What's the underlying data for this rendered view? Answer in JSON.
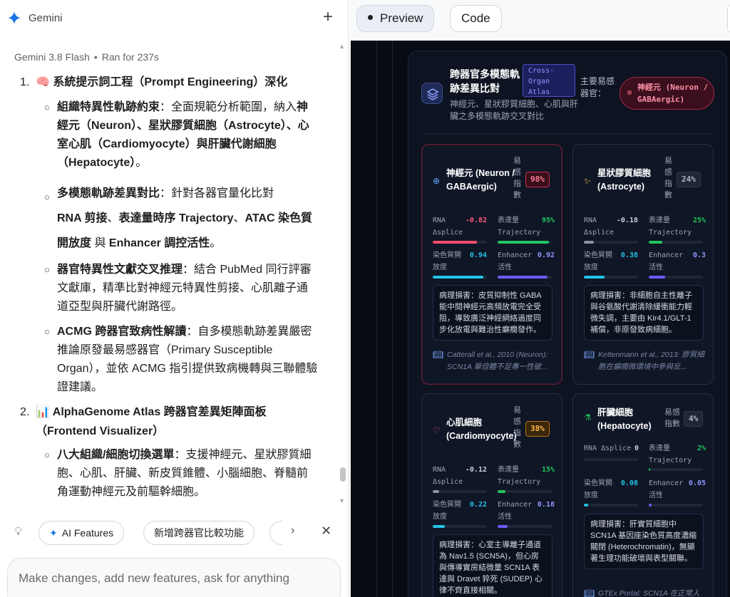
{
  "app": {
    "brand": "Gemini",
    "new_chat_icon": "plus-icon"
  },
  "run_meta": {
    "model": "Gemini 3.8 Flash",
    "status": "Ran for 237s"
  },
  "chat": {
    "sec1": {
      "num": "1.",
      "title": "🧠 系統提示詞工程（Prompt Engineering）深化"
    },
    "b1": {
      "bold": "組織特異性軌跡約束",
      "rest": "：全面規範分析範圍，納入",
      "bold2": "神經元（Neuron）、星狀膠質細胞（Astrocyte）、心室心肌（Cardiomyocyte）與肝臟代謝細胞（Hepatocyte）",
      "end": "。"
    },
    "b2": {
      "bold": "多模態軌跡差異對比",
      "rest": "：針對各器官量化比對",
      "l2a": "RNA 剪接",
      "l2b": "、",
      "l2c": "表達量時序 Trajectory",
      "l2d": "、",
      "l2e": "ATAC 染色質開放度",
      "l2f": " 與 ",
      "l2g": "Enhancer 調控活性",
      "l2h": "。"
    },
    "b3": {
      "bold": "器官特異性文獻交叉推理",
      "rest": "：結合 PubMed 同行評審文獻庫，精準比對神經元特異性剪接、心肌離子通道亞型與肝臟代謝路徑。"
    },
    "b4": {
      "bold": "ACMG 跨器官致病性解讀",
      "rest": "：自多模態軌跡差異嚴密推論原發最易感器官（Primary Susceptible Organ），並依 ACMG 指引提供致病機轉與三聯體驗證建議。"
    },
    "sec2": {
      "num": "2.",
      "title": "📊 AlphaGenome Atlas 跨器官差異矩陣面板（Frontend Visualizer）"
    },
    "b5": {
      "bold": "八大組織/細胞切換選單",
      "rest": "：支援神經元、星狀膠質細胞、心肌、肝臟、新皮質錐體、小腦細胞、脊髓前角運動神經元及前驅幹細胞。"
    }
  },
  "suggestions": {
    "chip1": "AI Features",
    "chip2": "新增跨器官比較功能",
    "chip3": ""
  },
  "composer": {
    "placeholder": "Make changes, add new features, ask for anything"
  },
  "right_tabs": {
    "preview": "Preview",
    "code": "Code"
  },
  "atlas": {
    "title": "跨器官多模態軌跡差異比對",
    "tag": "Cross-Organ Atlas",
    "subtitle": "神經元、星狀膠質細胞、心肌與肝臟之多模態軌跡交叉對比",
    "primary_label": "主要易感器官：",
    "primary_value": "神經元 (Neuron / GABAergic)",
    "susceptibility_label": "易感指數",
    "cards": [
      {
        "name": "神經元 (Neuron / GABAergic)",
        "icon": "neuron-icon",
        "score": "98%",
        "rna_label": "RNA Δsplice",
        "rna_value": "-0.82",
        "expr_label": "表達量 Trajectory",
        "expr_value": "95%",
        "atac_label": "染色質開放度",
        "atac_value": "0.94",
        "enh_label": "Enhancer 活性",
        "enh_value": "0.92",
        "note": "病理損害：皮質抑制性 GABA 能中間神經元高頻放電完全受阻，導致廣泛神經網絡過度同步化放電與難治性癲癇發作。",
        "ref": "Catterall et al., 2010 (Neuron): SCN1A 單倍體不足專一性破..."
      },
      {
        "name": "星狀膠質細胞 (Astrocyte)",
        "icon": "sparkle-icon",
        "score": "24%",
        "rna_label": "RNA Δsplice",
        "rna_value": "-0.18",
        "expr_label": "表達量 Trajectory",
        "expr_value": "25%",
        "atac_label": "染色質開放度",
        "atac_value": "0.38",
        "enh_label": "Enhancer 活性",
        "enh_value": "0.3",
        "note": "病理損害：非細胞自主性離子與谷氨酸代謝清除緩衝能力輕微失調，主要由 Kir4.1/GLT-1 補償，非原發致病細胞。",
        "ref": "Kettenmann et al., 2013: 膠質細胞在癲癇微環境中參與反..."
      },
      {
        "name": "心肌細胞 (Cardiomyocyte)",
        "icon": "heart-icon",
        "score": "38%",
        "rna_label": "RNA Δsplice",
        "rna_value": "-0.12",
        "expr_label": "表達量 Trajectory",
        "expr_value": "15%",
        "atac_label": "染色質開放度",
        "atac_value": "0.22",
        "enh_label": "Enhancer 活性",
        "enh_value": "0.18",
        "note": "病理損害：心室主導離子通道為 Nav1.5 (SCN5A)，但心房與傳導實房結微量 SCN1A 表達與 Dravet 猝死 (SUDEP) 心律不齊直接相關。",
        "ref": ""
      },
      {
        "name": "肝臟細胞 (Hepatocyte)",
        "icon": "flask-icon",
        "score": "4%",
        "rna_label": "RNA Δsplice",
        "rna_value": "0",
        "expr_label": "表達量 Trajectory",
        "expr_value": "2%",
        "atac_label": "染色質開放度",
        "atac_value": "0.08",
        "enh_label": "Enhancer 活性",
        "enh_value": "0.05",
        "note": "病理損害：肝實質細胞中 SCN1A 基因座染色質高度濃縮關閉 (Heterochromatin)，無顯著生理功能破壞與表型關聯。",
        "ref": "GTEx Portal: SCN1A 在正常人"
      }
    ]
  },
  "colors": {
    "accent_blue": "#1a73e8",
    "danger_red": "#c6304f",
    "expr_green": "#22c55e",
    "atac_cyan": "#22c3e6",
    "enh_purple": "#6a5cff"
  }
}
